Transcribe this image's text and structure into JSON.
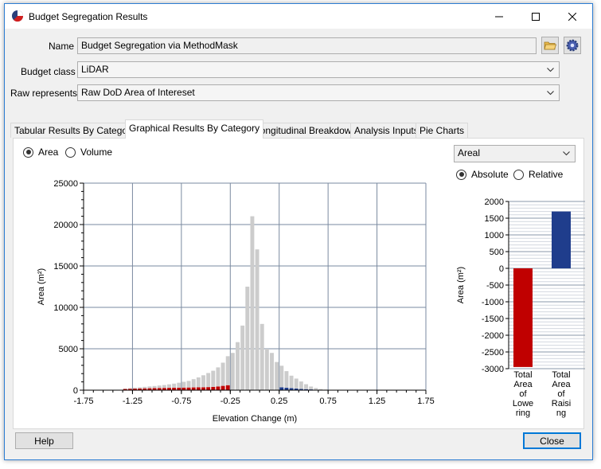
{
  "window": {
    "title": "Budget Segregation Results",
    "icon": "pie-chart-icon",
    "controls": [
      "minimize-icon",
      "maximize-icon",
      "close-icon"
    ]
  },
  "form": {
    "name_label": "Name",
    "name_value": "Budget Segregation via MethodMask",
    "budget_class_label": "Budget class",
    "budget_class_value": "LiDAR",
    "raw_represents_label": "Raw represents",
    "raw_represents_value": "Raw DoD Area of Intereset"
  },
  "tabs": [
    {
      "label": "Tabular Results By Category",
      "active": false
    },
    {
      "label": "Graphical Results By Category",
      "active": true
    },
    {
      "label": "Longitudinal Breakdown",
      "active": false
    },
    {
      "label": "Analysis Inputs",
      "active": false
    },
    {
      "label": "Pie Charts",
      "active": false
    }
  ],
  "histogram_options": {
    "area_label": "Area",
    "volume_label": "Volume",
    "selected": "Area"
  },
  "bar_options": {
    "dropdown_value": "Areal",
    "absolute_label": "Absolute",
    "relative_label": "Relative",
    "selected": "Absolute"
  },
  "footer": {
    "help_label": "Help",
    "close_label": "Close"
  },
  "colors": {
    "raising": "#1f3d8c",
    "lowering": "#c00000",
    "neutral": "#cccccc",
    "grid": "#7a8aa0"
  },
  "chart_data": [
    {
      "type": "bar",
      "title": "",
      "xlabel": "Elevation Change (m)",
      "ylabel": "Area (m²)",
      "xlim": [
        -1.75,
        1.75
      ],
      "ylim": [
        0,
        25000
      ],
      "xticks": [
        "-1.75",
        "-1.25",
        "-0.75",
        "-0.25",
        "0.25",
        "0.75",
        "1.25",
        "1.75"
      ],
      "yticks": [
        "0",
        "5000",
        "10000",
        "15000",
        "20000",
        "25000"
      ],
      "bin_width": 0.05,
      "bin_centers": [
        -1.725,
        -1.675,
        -1.625,
        -1.575,
        -1.525,
        -1.475,
        -1.425,
        -1.375,
        -1.325,
        -1.275,
        -1.225,
        -1.175,
        -1.125,
        -1.075,
        -1.025,
        -0.975,
        -0.925,
        -0.875,
        -0.825,
        -0.775,
        -0.725,
        -0.675,
        -0.625,
        -0.575,
        -0.525,
        -0.475,
        -0.425,
        -0.375,
        -0.325,
        -0.275,
        -0.225,
        -0.175,
        -0.125,
        -0.075,
        -0.025,
        0.025,
        0.075,
        0.125,
        0.175,
        0.225,
        0.275,
        0.325,
        0.375,
        0.425,
        0.475,
        0.525,
        0.575,
        0.625,
        0.675,
        0.725,
        0.775,
        0.825,
        0.875,
        0.925,
        0.975,
        1.025,
        1.075,
        1.125,
        1.175,
        1.225,
        1.275,
        1.325,
        1.375,
        1.425,
        1.475,
        1.525,
        1.575,
        1.625,
        1.675,
        1.725
      ],
      "series": [
        {
          "name": "",
          "color_key": "neutral",
          "values": [
            0,
            0,
            0,
            0,
            0,
            0,
            0,
            0,
            50,
            100,
            120,
            150,
            180,
            220,
            250,
            300,
            350,
            420,
            500,
            600,
            700,
            800,
            1000,
            1200,
            1450,
            1700,
            1950,
            2300,
            2800,
            3500,
            4500,
            5800,
            7800,
            12500,
            21000,
            17000,
            8000,
            5000,
            4500,
            3400,
            2600,
            2000,
            1500,
            1200,
            900,
            600,
            350,
            200,
            100,
            50,
            20,
            0,
            0,
            0,
            0,
            0,
            0,
            0,
            0,
            0,
            0,
            0,
            0,
            0,
            0,
            0,
            0,
            0,
            0,
            0
          ]
        },
        {
          "name": "",
          "color_key": "lowering",
          "values": [
            50,
            0,
            0,
            0,
            0,
            0,
            0,
            0,
            140,
            160,
            180,
            200,
            220,
            230,
            250,
            260,
            270,
            280,
            290,
            300,
            310,
            320,
            330,
            340,
            350,
            370,
            400,
            450,
            520,
            600,
            0,
            0,
            0,
            0,
            0,
            0,
            0,
            0,
            0,
            0,
            0,
            0,
            0,
            0,
            0,
            0,
            0,
            0,
            0,
            0,
            0,
            0,
            0,
            0,
            0,
            0,
            0,
            0,
            0,
            0,
            0,
            0,
            0,
            0,
            0,
            0,
            0,
            0,
            0,
            0
          ]
        },
        {
          "name": "",
          "color_key": "raising",
          "values": [
            0,
            0,
            0,
            0,
            0,
            0,
            0,
            0,
            0,
            0,
            0,
            0,
            0,
            0,
            0,
            0,
            0,
            0,
            0,
            0,
            0,
            0,
            0,
            0,
            0,
            0,
            0,
            0,
            0,
            0,
            0,
            0,
            0,
            0,
            0,
            0,
            0,
            0,
            0,
            0,
            350,
            300,
            250,
            200,
            150,
            120,
            90,
            60,
            40,
            20,
            0,
            0,
            0,
            0,
            0,
            0,
            0,
            0,
            0,
            0,
            0,
            0,
            0,
            0,
            0,
            0,
            0,
            0,
            0,
            0
          ]
        }
      ]
    },
    {
      "type": "bar",
      "title": "",
      "xlabel": "",
      "ylabel": "Area (m²)",
      "ylim": [
        -3000,
        2000
      ],
      "yticks": [
        "2000",
        "1500",
        "1000",
        "500",
        "0",
        "-500",
        "-1000",
        "-1500",
        "-2000",
        "-2500",
        "-3000"
      ],
      "categories": [
        "Total Area of Lowering",
        "Total Area of Raising"
      ],
      "category_label_lines": [
        [
          "Total",
          "Area",
          "of",
          "Lowe",
          "ring"
        ],
        [
          "Total",
          "Area",
          "of",
          "Raisi",
          "ng"
        ]
      ],
      "values": [
        -2950,
        1700
      ],
      "color_keys": [
        "lowering",
        "raising"
      ]
    }
  ]
}
